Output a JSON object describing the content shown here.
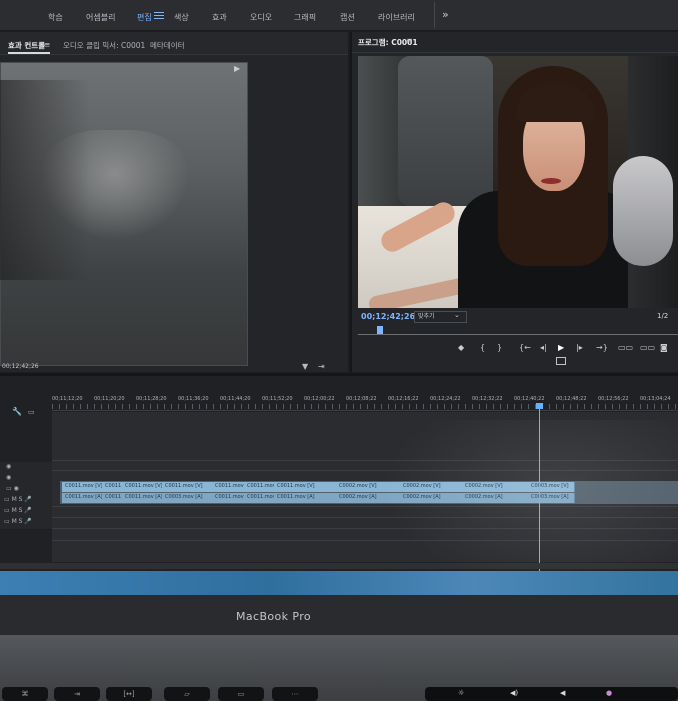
{
  "workspaces": {
    "items": [
      "학습",
      "어셈블리",
      "편집",
      "색상",
      "효과",
      "오디오",
      "그래픽",
      "캡션",
      "라이브러리"
    ],
    "active": "편집",
    "more_icon": "double-chevron-right"
  },
  "left_panel": {
    "tabs": [
      "효과 컨트롤",
      "오디오 클립 믹서: C0001",
      "메타데이터"
    ],
    "active_tab_menu_icon": "hamburger-menu",
    "timecode": "00;12;42;26"
  },
  "program_monitor": {
    "title": "프로그램: C0001",
    "menu_icon": "hamburger-menu",
    "timecode": "00;12;42;26",
    "fit": "맞추기",
    "resolution": "1/2",
    "controls": [
      "marker-icon",
      "in-point-icon",
      "out-point-icon",
      "go-to-in-icon",
      "step-back-icon",
      "play-icon",
      "step-forward-icon",
      "go-to-out-icon",
      "lift-icon",
      "extract-icon",
      "export-frame-icon"
    ]
  },
  "timeline": {
    "ruler_ticks": [
      "00;11;12;20",
      "00;11;20;20",
      "00;11;28;20",
      "00;11;36;20",
      "00;11;44;20",
      "00;11;52;20",
      "00;12;00;22",
      "00;12;08;22",
      "00;12;16;22",
      "00;12;24;22",
      "00;12;32;22",
      "00;12;40;22",
      "00;12;48;22",
      "00;12;56;22",
      "00;13;04;24"
    ],
    "video_clips": [
      "C0011.mov [V]",
      "C0011",
      "C0011.mov [V]",
      "C0011.mov [V]",
      "C0011.mov [V]",
      "C0011.mov [V]",
      "C0011.mov [V]",
      "C0002.mov [V]",
      "C0002.mov [V]",
      "C0002.mov [V]",
      "C0003.mov [V]"
    ],
    "audio_clips": [
      "C0011.mov [A]",
      "C0011",
      "C0011.mov [A]",
      "C0003.mov [A]",
      "C0011.mov [A]",
      "C0011.mov [A]",
      "C0011.mov [A]",
      "C0002.mov [A]",
      "C0002.mov [A]",
      "C0002.mov [A]",
      "C0003.mov [A]"
    ]
  },
  "device": {
    "label": "MacBook Pro",
    "keys": [
      "cmd-icon",
      "tab-icon",
      "bracket-icon",
      "screen-icon",
      "comment-icon",
      "more-icon"
    ]
  },
  "colors": {
    "accent": "#7fb6ff",
    "clip_video": "#8ab6d6",
    "clip_audio": "#7fa7c4",
    "playhead": "#66b2ff"
  }
}
